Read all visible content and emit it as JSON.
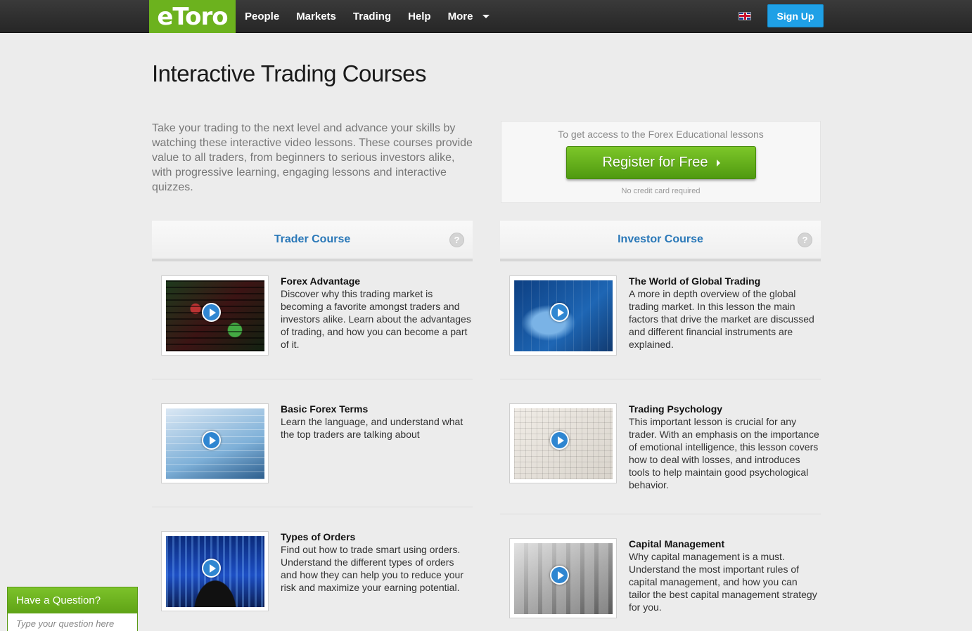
{
  "nav": {
    "logo": "eToro",
    "items": [
      "People",
      "Markets",
      "Trading",
      "Help"
    ],
    "more": "More",
    "signup": "Sign Up",
    "language_icon": "uk-flag-icon"
  },
  "page": {
    "title": "Interactive Trading Courses",
    "intro": "Take your trading to the next level and advance your skills by watching these interactive video lessons. These courses provide value to all traders, from beginners to serious investors alike, with progressive learning, engaging lessons and interactive quizzes."
  },
  "register": {
    "note": "To get access to the Forex Educational lessons",
    "button": "Register for Free",
    "sub": "No credit card required"
  },
  "courses": {
    "trader": {
      "title": "Trader Course",
      "help": "?",
      "lessons": [
        {
          "title": "Forex Advantage",
          "desc": "Discover why this trading market is becoming a favorite amongst traders and investors alike. Learn about the advantages of trading, and how you can become a part of it."
        },
        {
          "title": "Basic Forex Terms",
          "desc": "Learn the language, and understand what the top traders are talking about"
        },
        {
          "title": "Types of Orders",
          "desc": "Find out how to trade smart using orders. Understand the different types of orders and how they can help you to reduce your risk and maximize your earning potential."
        }
      ]
    },
    "investor": {
      "title": "Investor Course",
      "help": "?",
      "lessons": [
        {
          "title": "The World of Global Trading",
          "desc": "A more in depth overview of the global trading market. In this lesson the main factors that drive the market are discussed and different financial instruments are explained."
        },
        {
          "title": "Trading Psychology",
          "desc": "This important lesson is crucial for any trader. With an emphasis on the importance of emotional intelligence, this lesson covers how to deal with losses, and introduces tools to help maintain good psychological behavior."
        },
        {
          "title": "Capital Management",
          "desc": "Why capital management is a must. Understand the most important rules of capital management, and how you can tailor the best capital management strategy for you."
        }
      ]
    }
  },
  "chat": {
    "title": "Have a Question?",
    "placeholder": "Type your question here"
  },
  "colors": {
    "brand_green": "#6cb21e",
    "signup_blue": "#1fa0e6",
    "course_title_blue": "#2a78b8"
  }
}
